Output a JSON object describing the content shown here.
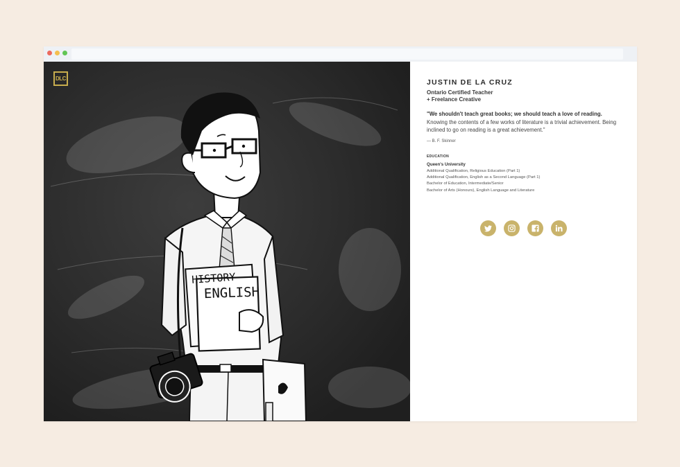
{
  "brand": {
    "logo_text": "DLC"
  },
  "profile": {
    "name": "JUSTIN DE LA CRUZ",
    "subtitle_line1": "Ontario Certified Teacher",
    "subtitle_line2": "+ Freelance Creative"
  },
  "quote": {
    "bold": "\"We shouldn't teach great books; we should teach a love of reading.",
    "rest": " Knowing the contents of a few works of literature is a trivial achievement. Being inclined to go on reading is a great achievement.\"",
    "attribution": "— B. F. Skinner"
  },
  "education": {
    "heading": "EDUCATION",
    "university": "Queen's University",
    "items": [
      "Additional Qualification, Religious Education (Part 1)",
      "Additional Qualification, English as a Second Language (Part 1)",
      "Bachelor of Education, Intermediate/Senior",
      "Bachelor of Arts (Honours), English Language and Literature"
    ]
  },
  "illustration": {
    "book_top": "HISTORY",
    "book_front": "ENGLISH"
  },
  "social": [
    {
      "icon": "twitter-icon"
    },
    {
      "icon": "instagram-icon"
    },
    {
      "icon": "facebook-icon"
    },
    {
      "icon": "linkedin-icon"
    }
  ],
  "colors": {
    "accent": "#c9b36b",
    "page_bg": "#f6ece2",
    "chalkboard": "#2a2a2a"
  }
}
